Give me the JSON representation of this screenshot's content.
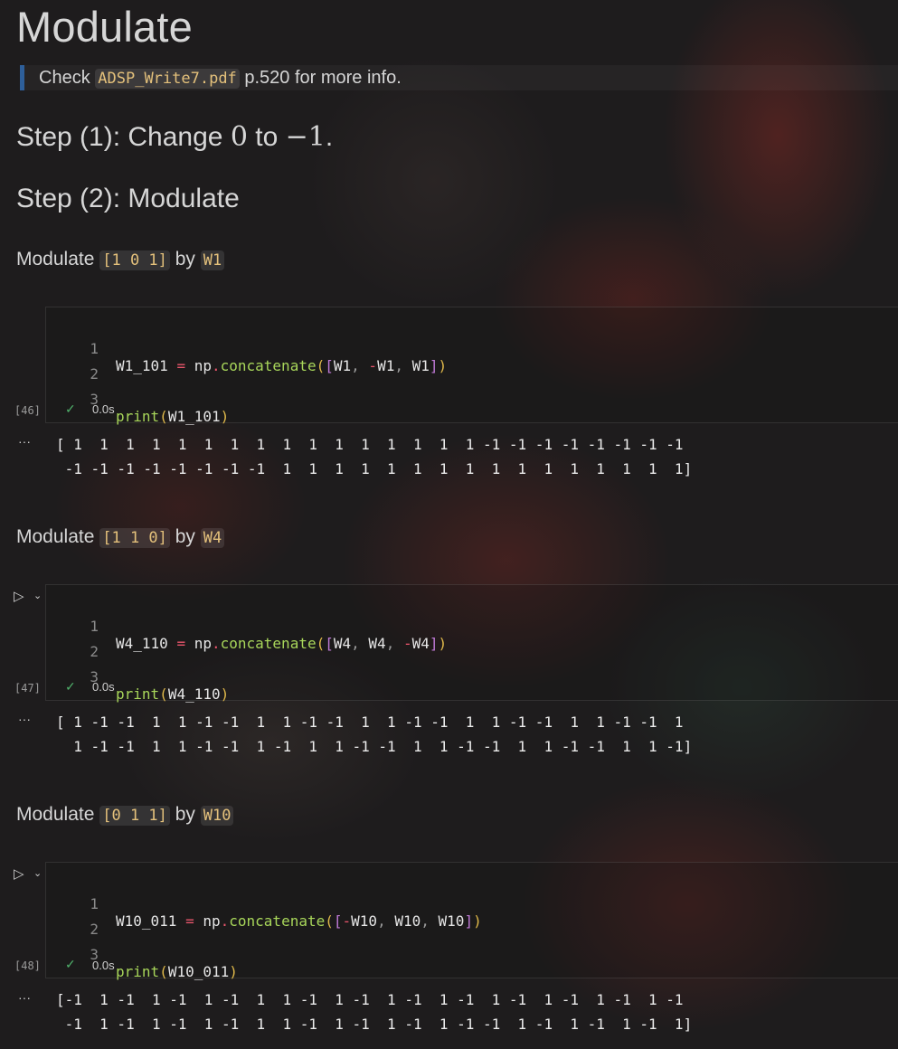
{
  "title": "Modulate",
  "note": {
    "prefix": "Check",
    "file": "ADSP_Write7.pdf",
    "suffix": "p.520 for more info."
  },
  "step1": {
    "prefix": "Step (1): Change ",
    "from": "0",
    "middle": " to ",
    "to": "−1",
    "end": "."
  },
  "step2": "Step (2): Modulate",
  "sections": [
    {
      "label": "Modulate",
      "bits": "[1 0 1]",
      "by": "by",
      "w": "W1",
      "code": {
        "n1": "1",
        "n2": "2",
        "n3": "3",
        "var": "W1_101",
        "eq": "=",
        "np": "np",
        "dot": ".",
        "fn": "concatenate",
        "open": "(",
        "lb": "[",
        "a_sign": "",
        "a": "W1",
        "c1": ",",
        "b_sign": "-",
        "b": "W1",
        "c2": ",",
        "c_sign": "",
        "c": "W1",
        "rb": "]",
        "close": ")",
        "print": "print",
        "popen": "(",
        "parg": "W1_101",
        "pclose": ")"
      },
      "exec_count": "[46]",
      "check": "✓",
      "duration": "0.0s",
      "ellipsis": "···",
      "output": [
        "[ 1  1  1  1  1  1  1  1  1  1  1  1  1  1  1  1 -1 -1 -1 -1 -1 -1 -1 -1",
        " -1 -1 -1 -1 -1 -1 -1 -1  1  1  1  1  1  1  1  1  1  1  1  1  1  1  1  1]"
      ]
    },
    {
      "label": "Modulate",
      "bits": "[1 1 0]",
      "by": "by",
      "w": "W4",
      "code": {
        "n1": "1",
        "n2": "2",
        "n3": "3",
        "var": "W4_110",
        "eq": "=",
        "np": "np",
        "dot": ".",
        "fn": "concatenate",
        "open": "(",
        "lb": "[",
        "a_sign": "",
        "a": "W4",
        "c1": ",",
        "b_sign": "",
        "b": "W4",
        "c2": ",",
        "c_sign": "-",
        "c": "W4",
        "rb": "]",
        "close": ")",
        "print": "print",
        "popen": "(",
        "parg": "W4_110",
        "pclose": ")"
      },
      "exec_count": "[47]",
      "check": "✓",
      "duration": "0.0s",
      "ellipsis": "···",
      "run": "▷",
      "chevron": "⌄",
      "output": [
        "[ 1 -1 -1  1  1 -1 -1  1  1 -1 -1  1  1 -1 -1  1  1 -1 -1  1  1 -1 -1  1",
        "  1 -1 -1  1  1 -1 -1  1 -1  1  1 -1 -1  1  1 -1 -1  1  1 -1 -1  1  1 -1]"
      ]
    },
    {
      "label": "Modulate",
      "bits": "[0 1 1]",
      "by": "by",
      "w": "W10",
      "code": {
        "n1": "1",
        "n2": "2",
        "n3": "3",
        "var": "W10_011",
        "eq": "=",
        "np": "np",
        "dot": ".",
        "fn": "concatenate",
        "open": "(",
        "lb": "[",
        "a_sign": "-",
        "a": "W10",
        "c1": ",",
        "b_sign": "",
        "b": "W10",
        "c2": ",",
        "c_sign": "",
        "c": "W10",
        "rb": "]",
        "close": ")",
        "print": "print",
        "popen": "(",
        "parg": "W10_011",
        "pclose": ")"
      },
      "exec_count": "[48]",
      "check": "✓",
      "duration": "0.0s",
      "ellipsis": "···",
      "run": "▷",
      "chevron": "⌄",
      "output": [
        "[-1  1 -1  1 -1  1 -1  1  1 -1  1 -1  1 -1  1 -1  1 -1  1 -1  1 -1  1 -1",
        " -1  1 -1  1 -1  1 -1  1  1 -1  1 -1  1 -1  1 -1 -1  1 -1  1 -1  1 -1  1]"
      ]
    }
  ]
}
